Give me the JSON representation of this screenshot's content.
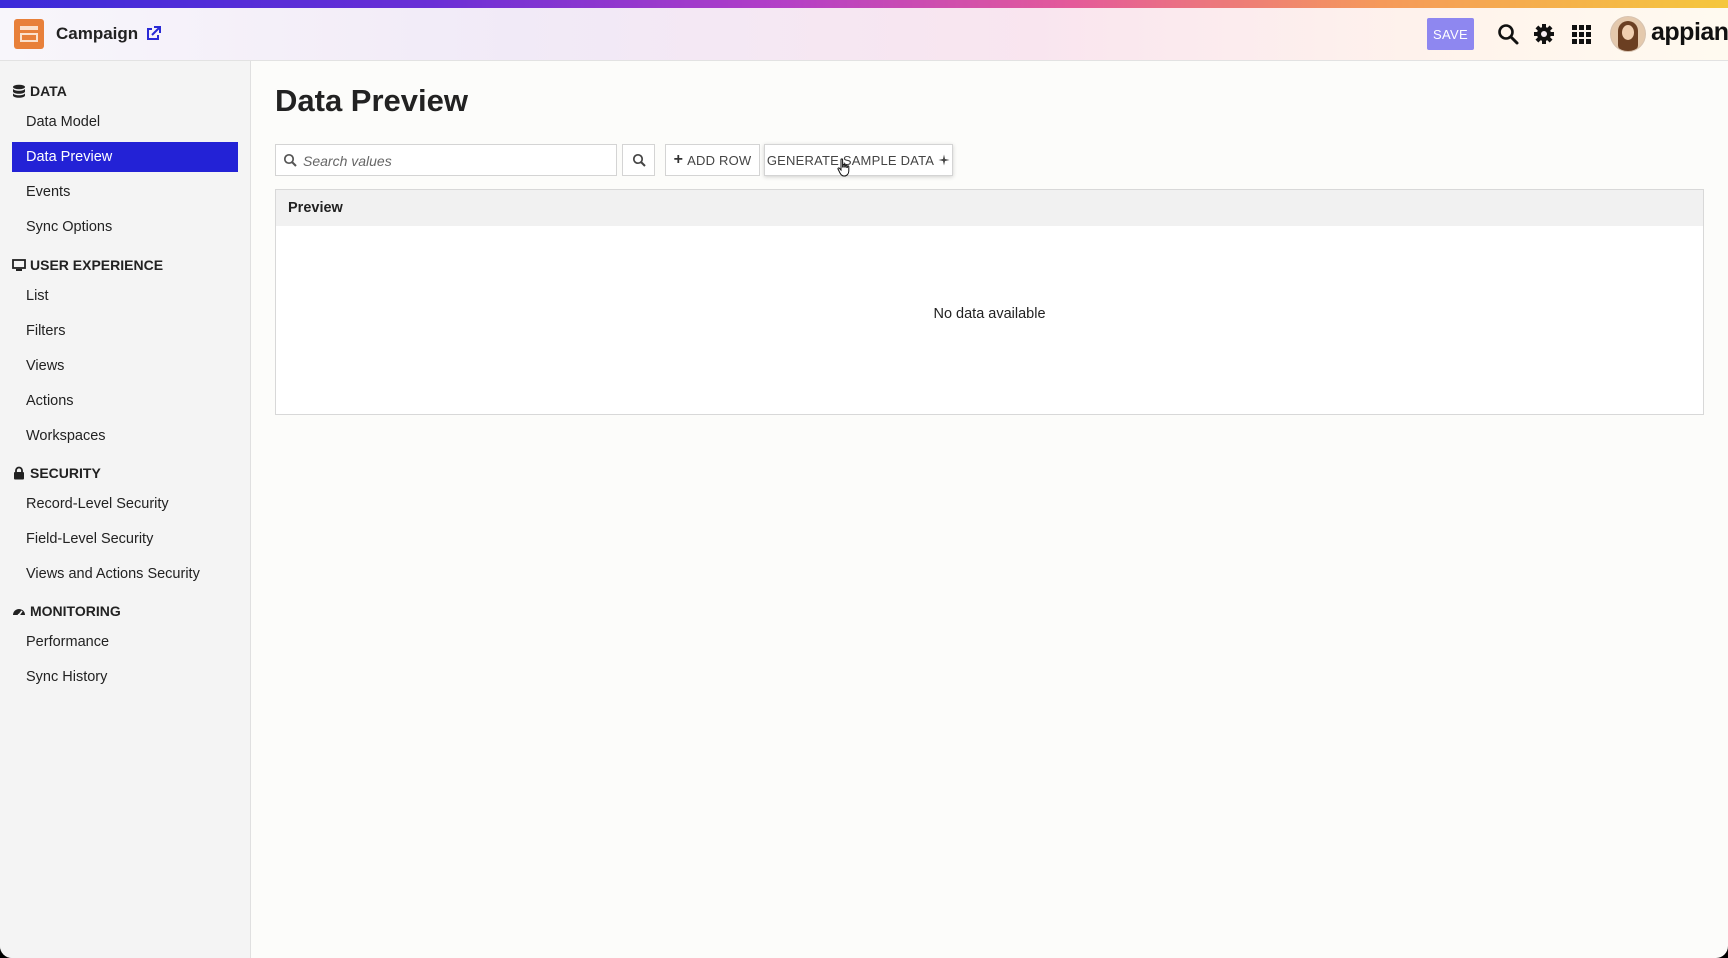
{
  "header": {
    "app_title": "Campaign",
    "save_label": "SAVE",
    "brand": "appian",
    "colors": {
      "save_button": "#8e87f0",
      "accent": "#2322d6",
      "app_icon": "#e8803a"
    },
    "icons": [
      "open-external-icon",
      "search-icon",
      "gear-icon",
      "apps-grid-icon",
      "avatar"
    ]
  },
  "sidebar": {
    "sections": [
      {
        "label": "DATA",
        "icon": "database-icon",
        "items": [
          "Data Model",
          "Data Preview",
          "Events",
          "Sync Options"
        ]
      },
      {
        "label": "USER EXPERIENCE",
        "icon": "monitor-icon",
        "items": [
          "List",
          "Filters",
          "Views",
          "Actions",
          "Workspaces"
        ]
      },
      {
        "label": "SECURITY",
        "icon": "lock-icon",
        "items": [
          "Record-Level Security",
          "Field-Level Security",
          "Views and Actions Security"
        ]
      },
      {
        "label": "MONITORING",
        "icon": "gauge-icon",
        "items": [
          "Performance",
          "Sync History"
        ]
      }
    ],
    "active_item": "Data Preview"
  },
  "main": {
    "page_title": "Data Preview",
    "search_placeholder": "Search values",
    "add_row_label": "ADD ROW",
    "generate_label": "GENERATE SAMPLE DATA",
    "panel_title": "Preview",
    "empty_message": "No data available"
  }
}
